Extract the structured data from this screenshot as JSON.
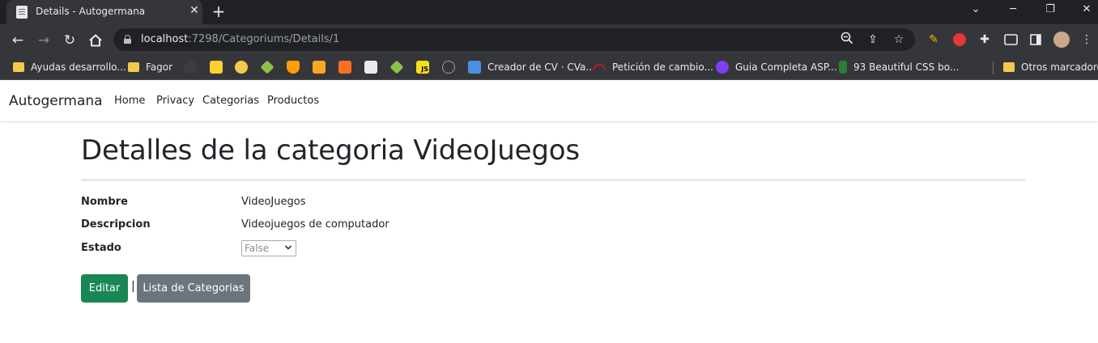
{
  "browser": {
    "tab_title": "Details - Autogermana",
    "url_host": "localhost",
    "url_path": ":7298/Categoriums/Details/1",
    "bookmarks": [
      {
        "label": "Ayudas desarrollo..."
      },
      {
        "label": "Fagor"
      },
      {
        "label": "Creador de CV · CVa..."
      },
      {
        "label": "Petición de cambio..."
      },
      {
        "label": "Guia Completa ASP..."
      },
      {
        "label": "93 Beautiful CSS bo..."
      },
      {
        "label": "Otros marcadores"
      }
    ],
    "icon_bookmarks": [
      "JS"
    ]
  },
  "site": {
    "brand": "Autogermana",
    "nav": [
      "Home",
      "Privacy",
      "Categorias",
      "Productos"
    ]
  },
  "details": {
    "title": "Detalles de la categoria VideoJuegos",
    "fields": [
      {
        "label": "Nombre",
        "value": "VideoJuegos"
      },
      {
        "label": "Descripcion",
        "value": "Videojuegos de computador"
      },
      {
        "label": "Estado",
        "value": "False"
      }
    ]
  },
  "actions": {
    "edit": "Editar",
    "separator": "|",
    "list": "Lista de Categorias"
  },
  "colors": {
    "edit_button": "#198754",
    "list_button": "#6c757d",
    "chrome_dark": "#202124",
    "chrome_toolbar": "#35363a"
  }
}
